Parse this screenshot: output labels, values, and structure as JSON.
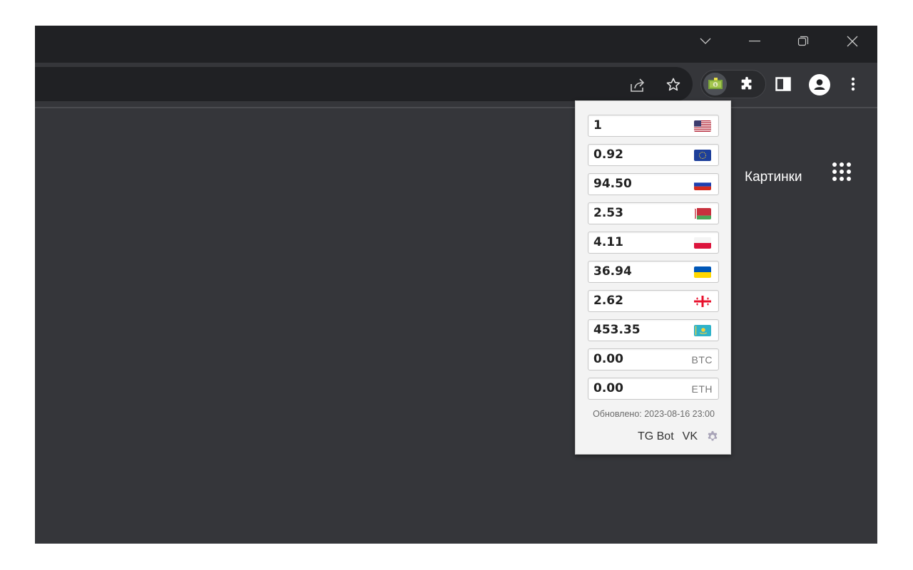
{
  "browser": {
    "window_controls": [
      "tab-search",
      "minimize",
      "restore",
      "close"
    ],
    "toolbar_icons": [
      "share-icon",
      "bookmark-star-icon",
      "currency-extension-icon",
      "extensions-puzzle-icon",
      "side-panel-icon",
      "profile-icon",
      "menu-kebab-icon"
    ]
  },
  "page": {
    "images_link": "Картинки"
  },
  "popup": {
    "rates": [
      {
        "value": "1",
        "flag": "us"
      },
      {
        "value": "0.92",
        "flag": "eu"
      },
      {
        "value": "94.50",
        "flag": "ru"
      },
      {
        "value": "2.53",
        "flag": "by"
      },
      {
        "value": "4.11",
        "flag": "pl"
      },
      {
        "value": "36.94",
        "flag": "ua"
      },
      {
        "value": "2.62",
        "flag": "ge"
      },
      {
        "value": "453.35",
        "flag": "kz"
      },
      {
        "value": "0.00",
        "code": "BTC"
      },
      {
        "value": "0.00",
        "code": "ETH"
      }
    ],
    "updated": "Обновлено: 2023-08-16 23:00",
    "link_tg": "TG Bot",
    "link_vk": "VK"
  },
  "colors": {
    "titlebar": "#202124",
    "toolbar": "#35363a",
    "popup_bg": "#f3f3f3"
  }
}
